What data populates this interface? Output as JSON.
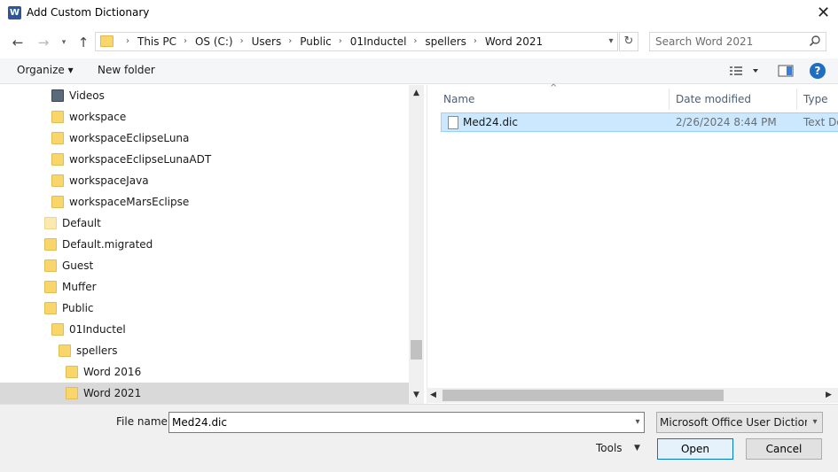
{
  "window": {
    "title": "Add Custom Dictionary",
    "app_icon": "word-icon"
  },
  "address": {
    "crumbs": [
      "This PC",
      "OS (C:)",
      "Users",
      "Public",
      "01Inductel",
      "spellers",
      "Word 2021"
    ]
  },
  "search": {
    "placeholder": "Search Word 2021"
  },
  "toolbar": {
    "organize_label": "Organize ▾",
    "new_folder_label": "New folder"
  },
  "nav_tree": [
    {
      "label": "Videos",
      "icon": "video-folder-icon",
      "level": 2
    },
    {
      "label": "workspace",
      "icon": "folder-icon",
      "level": 2
    },
    {
      "label": "workspaceEclipseLuna",
      "icon": "folder-icon",
      "level": 2
    },
    {
      "label": "workspaceEclipseLunaADT",
      "icon": "folder-icon",
      "level": 2
    },
    {
      "label": "workspaceJava",
      "icon": "folder-icon",
      "level": 2
    },
    {
      "label": "workspaceMarsEclipse",
      "icon": "folder-icon",
      "level": 2
    },
    {
      "label": "Default",
      "icon": "folder-icon",
      "level": 1,
      "muted": true
    },
    {
      "label": "Default.migrated",
      "icon": "folder-icon",
      "level": 1
    },
    {
      "label": "Guest",
      "icon": "folder-icon",
      "level": 1
    },
    {
      "label": "Muffer",
      "icon": "folder-icon",
      "level": 1
    },
    {
      "label": "Public",
      "icon": "folder-icon",
      "level": 1
    },
    {
      "label": "01Inductel",
      "icon": "folder-icon",
      "level": 2
    },
    {
      "label": "spellers",
      "icon": "folder-icon",
      "level": 3
    },
    {
      "label": "Word 2016",
      "icon": "folder-icon",
      "level": 4
    },
    {
      "label": "Word 2021",
      "icon": "folder-icon",
      "level": 4,
      "selected": true
    }
  ],
  "file_list": {
    "columns": {
      "name": "Name",
      "date": "Date modified",
      "type": "Type"
    },
    "files": [
      {
        "name": "Med24.dic",
        "date": "2/26/2024 8:44 PM",
        "type": "Text Doc",
        "selected": true
      }
    ]
  },
  "bottom": {
    "file_name_label": "File name:",
    "file_name_value": "Med24.dic",
    "file_type_value": "Microsoft Office User Dictionary",
    "tools_label": "Tools",
    "open_label": "Open",
    "cancel_label": "Cancel"
  },
  "colors": {
    "accent": "#0078d7",
    "selection": "#cce8ff",
    "folder": "#f9d66b"
  }
}
